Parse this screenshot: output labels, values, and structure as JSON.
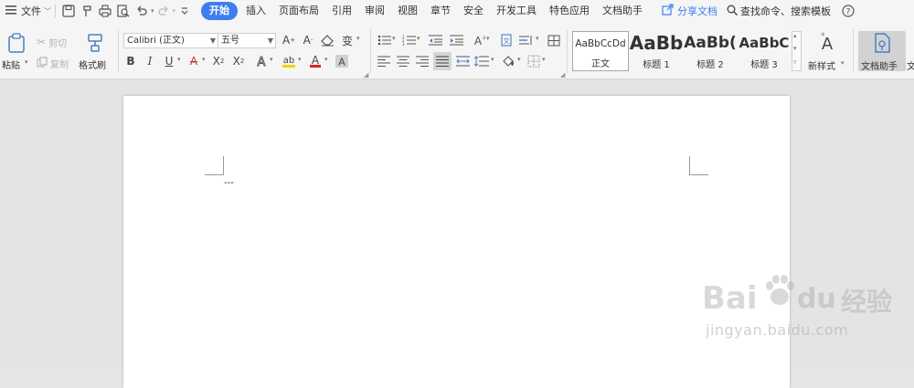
{
  "menubar": {
    "file_label": "文件",
    "tabs": [
      {
        "label": "开始",
        "active": true
      },
      {
        "label": "插入"
      },
      {
        "label": "页面布局"
      },
      {
        "label": "引用"
      },
      {
        "label": "审阅"
      },
      {
        "label": "视图"
      },
      {
        "label": "章节"
      },
      {
        "label": "安全"
      },
      {
        "label": "开发工具"
      },
      {
        "label": "特色应用"
      },
      {
        "label": "文档助手"
      }
    ],
    "share_label": "分享文档",
    "search_label": "查找命令、搜索模板",
    "help_icon": "question-circle-icon",
    "accent_color": "#3d7eee"
  },
  "ribbon": {
    "clipboard": {
      "paste_label": "粘贴",
      "cut_label": "剪切",
      "copy_label": "复制",
      "format_painter_label": "格式刷"
    },
    "font": {
      "font_name": "Calibri (正文)",
      "font_size": "五号"
    },
    "styles": [
      {
        "preview": "AaBbCcDd",
        "name": "正文"
      },
      {
        "preview": "AaBb",
        "name": "标题 1"
      },
      {
        "preview": "AaBb(",
        "name": "标题 2"
      },
      {
        "preview": "AaBbC",
        "name": "标题 3"
      }
    ],
    "new_style_label": "新样式",
    "doc_helper_label": "文档助手",
    "doc_helper_extra": "文"
  },
  "document": {
    "content": "---"
  },
  "watermark": {
    "brand": "Bai",
    "brand2": "du",
    "cn": "经验",
    "url": "jingyan.baidu.com"
  }
}
